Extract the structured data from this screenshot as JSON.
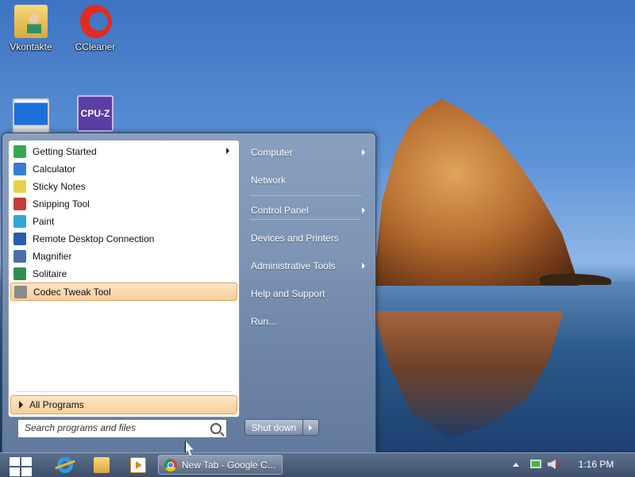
{
  "desktop": {
    "icons": [
      {
        "label": "Vkontakte",
        "icon": "folder-user-icon"
      },
      {
        "label": "CCleaner",
        "icon": "ccleaner-icon"
      },
      {
        "label": "",
        "icon": "computer-icon"
      },
      {
        "label": "",
        "icon": "cpuz-icon",
        "badge": "CPU-Z"
      }
    ]
  },
  "start_menu": {
    "programs": [
      {
        "label": "Getting Started",
        "icon": "getting-started-icon",
        "has_submenu": true,
        "color": "#3aa655"
      },
      {
        "label": "Calculator",
        "icon": "calculator-icon",
        "has_submenu": false,
        "color": "#3b7bd4"
      },
      {
        "label": "Sticky Notes",
        "icon": "sticky-notes-icon",
        "has_submenu": false,
        "color": "#e8d24a"
      },
      {
        "label": "Snipping Tool",
        "icon": "scissors-icon",
        "has_submenu": false,
        "color": "#c63b3b"
      },
      {
        "label": "Paint",
        "icon": "paint-icon",
        "has_submenu": false,
        "color": "#2fa7d6"
      },
      {
        "label": "Remote Desktop Connection",
        "icon": "remote-desktop-icon",
        "has_submenu": false,
        "color": "#2a5db0"
      },
      {
        "label": "Magnifier",
        "icon": "magnifier-icon",
        "has_submenu": false,
        "color": "#4d6fa8"
      },
      {
        "label": "Solitaire",
        "icon": "solitaire-icon",
        "has_submenu": false,
        "color": "#2f8f4f"
      },
      {
        "label": "Codec Tweak Tool",
        "icon": "tools-icon",
        "has_submenu": false,
        "selected": true,
        "color": "#8a8a8a"
      }
    ],
    "all_programs_label": "All Programs",
    "search": {
      "placeholder": "Search programs and files",
      "value": ""
    },
    "right_items": [
      {
        "label": "Computer",
        "has_submenu": true
      },
      {
        "label": "Network",
        "has_submenu": false
      },
      {
        "label": "Control Panel",
        "has_submenu": true
      },
      {
        "label": "Devices and Printers",
        "has_submenu": false
      },
      {
        "label": "Administrative Tools",
        "has_submenu": true
      },
      {
        "label": "Help and Support",
        "has_submenu": false
      },
      {
        "label": "Run...",
        "has_submenu": false
      }
    ],
    "shutdown_label": "Shut down"
  },
  "taskbar": {
    "pinned": [
      "internet-explorer-icon",
      "file-explorer-icon",
      "media-player-icon"
    ],
    "tasks": [
      {
        "label": "New Tab - Google C...",
        "icon": "chrome-icon"
      }
    ],
    "tray": {
      "icons": [
        "show-hidden-icons-arrow",
        "network-icon",
        "volume-muted-icon"
      ]
    },
    "clock": "1:16 PM"
  },
  "colors": {
    "selection": "#f8cf9b",
    "start_menu_bg": "#7a8aa6",
    "taskbar_bg": "#4a5b78"
  }
}
